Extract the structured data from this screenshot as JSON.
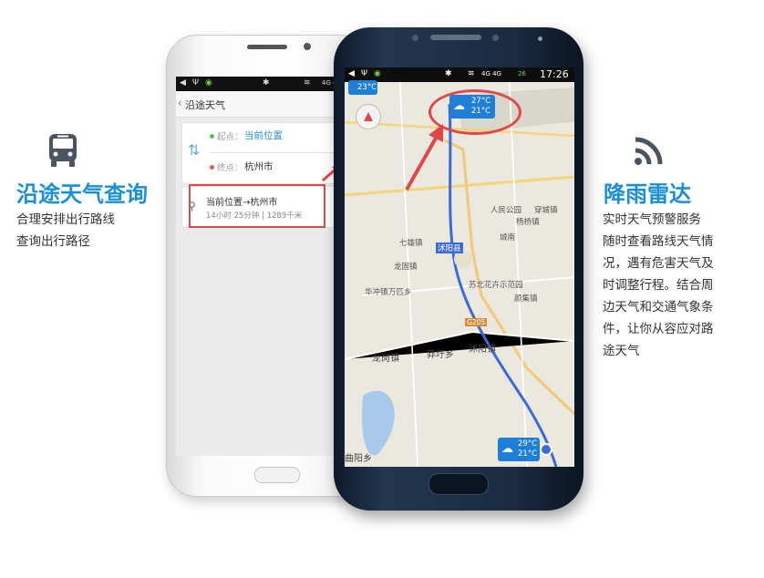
{
  "left_feature": {
    "icon": "bus-icon",
    "title": "沿途天气查询",
    "lines": [
      "合理安排出行路线",
      "查询出行路径"
    ]
  },
  "right_feature": {
    "icon": "signal-icon",
    "title": "降雨雷达",
    "lines": [
      "实时天气预警服务",
      "随时查看路线天气情",
      "况，遇有危害天气及",
      "时调整行程。结合周",
      "边天气和交通气象条",
      "件，让你从容应对路",
      "途天气"
    ]
  },
  "white_phone": {
    "status_signal": "4G 4G",
    "header_title": "沿途天气",
    "start_label": "起点：",
    "start_value": "当前位置",
    "end_label": "终点：",
    "end_value": "杭州市",
    "history_route": "当前位置→杭州市",
    "history_detail": "14小时 25分钟 | 1289千米"
  },
  "dark_phone": {
    "status_signal": "4G 4G",
    "status_battery": "26",
    "status_time": "17:26",
    "top_chip_temp": "23°C",
    "highlight_chip": {
      "high": "27°C",
      "low": "21°C"
    },
    "bottom_chip": {
      "high": "29°C",
      "low": "21°C"
    },
    "map_labels": {
      "town_left": "七雄镇",
      "town_mid": "龙固镇",
      "town_a": "华冲镇",
      "town_b": "万匹乡",
      "town_c": "龙岗镇",
      "town_d": "莽圩乡",
      "town_e": "沭阳县",
      "town_f": "沭阳镇",
      "town_g": "颜集镇",
      "town_h": "苏北花卉示范园",
      "road": "G205",
      "city_bottom": "曲阳乡",
      "park": "人民公园",
      "town_i": "穿城镇",
      "town_j": "杨桥镇",
      "town_k": "城南"
    }
  }
}
